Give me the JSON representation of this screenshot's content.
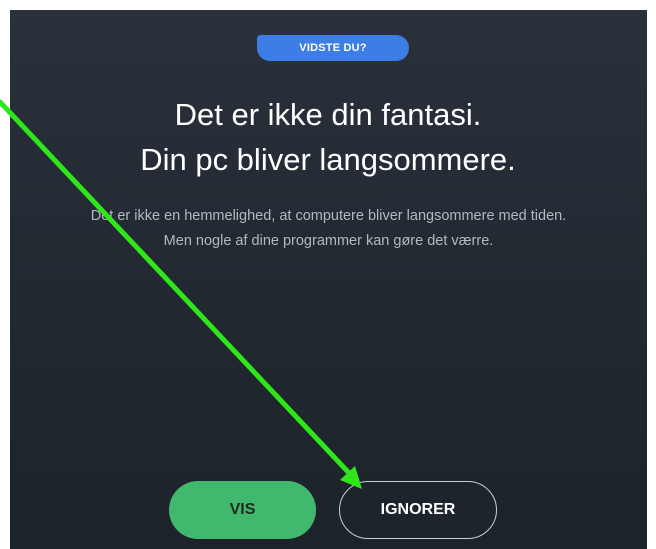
{
  "badge": {
    "label": "VIDSTE DU?"
  },
  "heading": {
    "line1": "Det er ikke din fantasi.",
    "line2": "Din pc bliver langsommere."
  },
  "description": {
    "line1": "Det er ikke en hemmelighed, at computere bliver langsommere med tiden.",
    "line2": "Men nogle af dine programmer kan gøre det værre."
  },
  "actions": {
    "show_label": "VIS",
    "ignore_label": "IGNORER"
  },
  "colors": {
    "background": "#232a33",
    "badge": "#3c7ee6",
    "primary_button": "#40b86e",
    "annotation_arrow": "#2ee61a"
  }
}
